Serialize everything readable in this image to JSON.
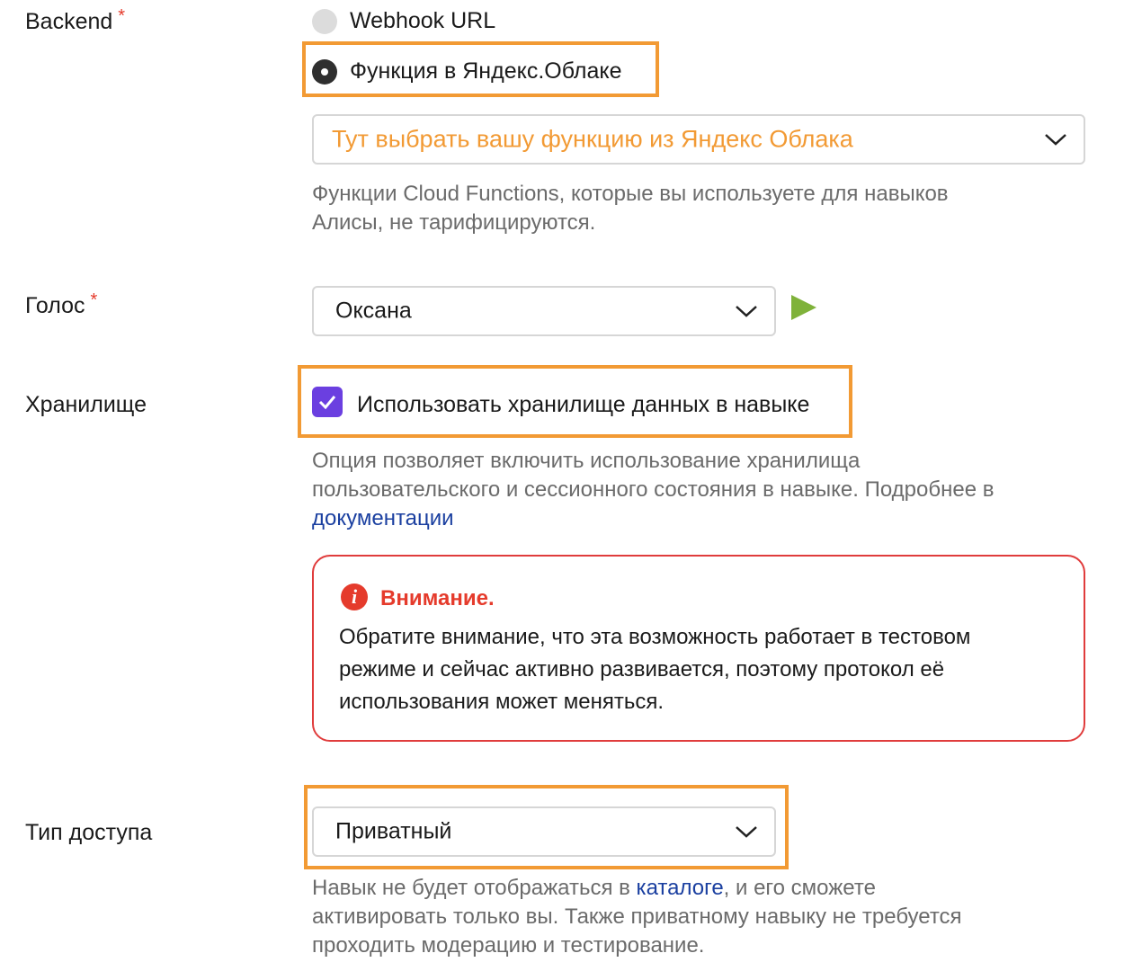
{
  "backend": {
    "label": "Backend",
    "required_mark": "*",
    "options": [
      {
        "label": "Webhook URL",
        "selected": false
      },
      {
        "label": "Функция в Яндекс.Облаке",
        "selected": true
      }
    ],
    "function_select": {
      "placeholder": "Тут выбрать вашу функцию из Яндекс Облака",
      "placeholder_color": "#f29a34"
    },
    "hint_lines": [
      "Функции Cloud Functions, которые вы используете для навыков",
      "Алисы, не тарифицируются."
    ]
  },
  "voice": {
    "label": "Голос",
    "required_mark": "*",
    "value": "Оксана",
    "play_icon": "play-icon",
    "play_color": "#7fb23a"
  },
  "storage": {
    "label": "Хранилище",
    "checkbox_label": "Использовать хранилище данных в навыке",
    "checked": true,
    "checkbox_color": "#6b3fe0",
    "hint_lines": [
      "Опция позволяет включить использование хранилища",
      "пользовательского и сессионного состояния в навыке. Подробнее в"
    ],
    "hint_link": "документации"
  },
  "alert": {
    "icon": "info-icon",
    "title": "Внимание.",
    "body_lines": [
      "Обратите внимание, что эта возможность работает в тестовом",
      "режиме и сейчас активно развивается, поэтому протокол её",
      "использования может меняться."
    ],
    "color": "#e03c3c"
  },
  "access": {
    "label": "Тип доступа",
    "value": "Приватный",
    "hint_prefix": "Навык не будет отображаться в ",
    "hint_link": "каталоге",
    "hint_suffix": ", и его сможете",
    "hint_lines": [
      "активировать только вы. Также приватному навыку не требуется",
      "проходить модерацию и тестирование."
    ]
  },
  "colors": {
    "highlight": "#f29a34",
    "link": "#1a3fa0",
    "required": "#e53b2c"
  }
}
